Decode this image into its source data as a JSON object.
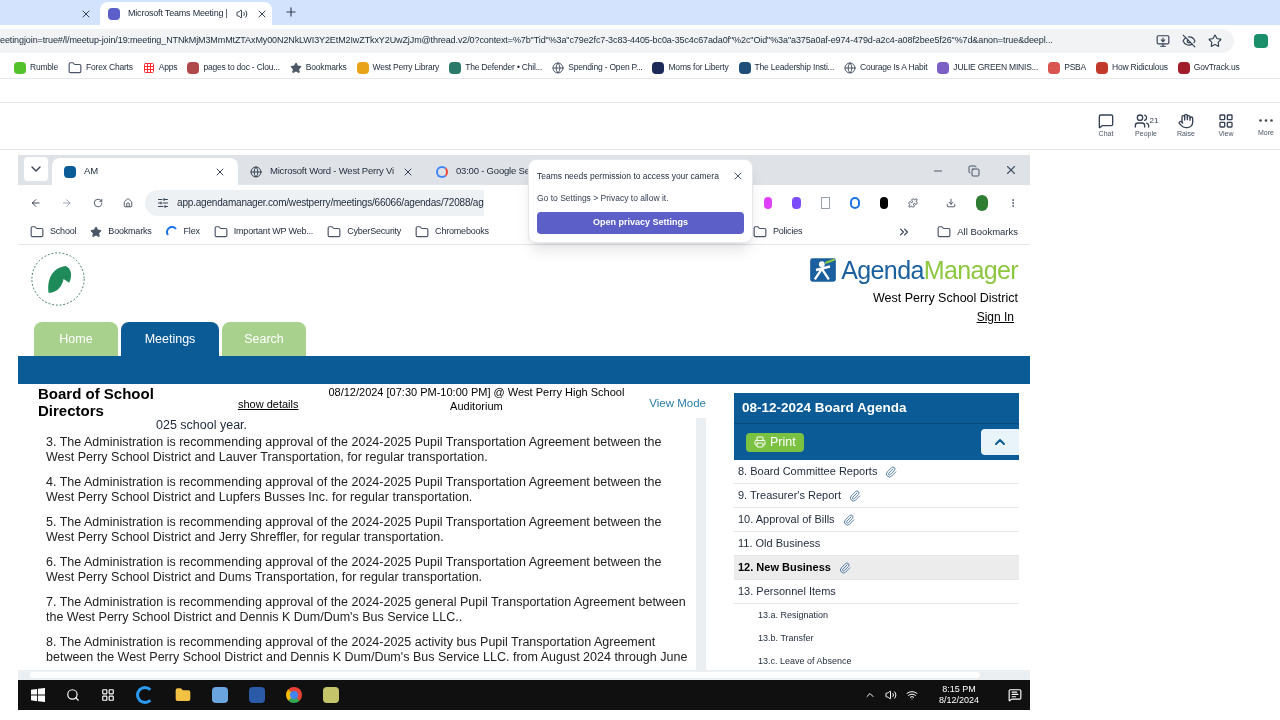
{
  "browser": {
    "tabs": [
      {
        "selected": false
      },
      {
        "title": "Microsoft Teams Meeting |",
        "selected": true,
        "audio": true
      }
    ],
    "url": "eetingjoin=true#/l/meetup-join/19:meeting_NTNkMjM3MmMtZTAxMy00N2NkLWI3Y2EtM2IwZTkxY2UwZjJm@thread.v2/0?context=%7b\"Tid\"%3a\"c79e2fc7-3c83-4405-bc0a-35c4c67ada0f\"%2c\"Oid\"%3a\"a375a0af-e974-479d-a2c4-a08f2bee5f26\"%7d&anon=true&deepl...",
    "bookmarks": [
      {
        "label": "Rumble",
        "kind": "site",
        "color": "#53c22b"
      },
      {
        "label": "Forex Charts",
        "kind": "folder"
      },
      {
        "label": "Apps",
        "kind": "apps"
      },
      {
        "label": "pages to doc - Clou...",
        "kind": "site",
        "color": "#b04a4a"
      },
      {
        "label": "Bookmarks",
        "kind": "star"
      },
      {
        "label": "West Perry Library",
        "kind": "site",
        "color": "#e8a317"
      },
      {
        "label": "The Defender • Chil...",
        "kind": "site",
        "color": "#2a7a6a"
      },
      {
        "label": "Spending - Open P...",
        "kind": "globe"
      },
      {
        "label": "Moms for Liberty",
        "kind": "site",
        "color": "#1c2a5a"
      },
      {
        "label": "The Leadership Insti...",
        "kind": "site",
        "color": "#1f4e79"
      },
      {
        "label": "Courage Is A Habit",
        "kind": "globe"
      },
      {
        "label": "JULIE GREEN MINIS...",
        "kind": "site",
        "color": "#7b5fc4"
      },
      {
        "label": "PSBA",
        "kind": "site",
        "color": "#d9534f"
      },
      {
        "label": "How Ridiculous",
        "kind": "site",
        "color": "#c0392b"
      },
      {
        "label": "GovTrack.us",
        "kind": "site",
        "color": "#a01d2a"
      }
    ]
  },
  "teams_toolbar": [
    {
      "label": "Chat",
      "kind": "chat"
    },
    {
      "label": "People",
      "kind": "people",
      "count": "21"
    },
    {
      "label": "Raise",
      "kind": "raise"
    },
    {
      "label": "View",
      "kind": "view"
    },
    {
      "label": "More",
      "kind": "more"
    }
  ],
  "shared_screen": {
    "browser": {
      "tabs": [
        {
          "title": "AM",
          "selected": true,
          "kind": "site"
        },
        {
          "title": "Microsoft Word - West Perry Vi",
          "selected": false,
          "kind": "globe"
        },
        {
          "title": "03:00 - Google Se",
          "selected": false,
          "kind": "google"
        }
      ],
      "url": "app.agendamanager.com/westperry/meetings/66066/agendas/72088/ag",
      "bookmarks": [
        {
          "label": "School",
          "kind": "folder"
        },
        {
          "label": "Bookmarks",
          "kind": "star"
        },
        {
          "label": "Flex",
          "kind": "flex"
        },
        {
          "label": "Important WP Web...",
          "kind": "folder"
        },
        {
          "label": "CyberSecurity",
          "kind": "folder"
        },
        {
          "label": "Chromebooks",
          "kind": "folder"
        },
        {
          "label": "Policies",
          "kind": "folder"
        }
      ],
      "all_bookmarks": "All Bookmarks"
    },
    "popup": {
      "title": "Teams needs permission to access your camera",
      "body": "Go to Settings > Privacy to allow it.",
      "button": "Open privacy Settings"
    },
    "page": {
      "brand": {
        "first": "Agenda",
        "second": "Manager"
      },
      "district": "West Perry School District",
      "sign_in": "Sign In",
      "nav": [
        {
          "label": "Home",
          "selected": false
        },
        {
          "label": "Meetings",
          "selected": true
        },
        {
          "label": "Search",
          "selected": false
        }
      ],
      "meeting": {
        "title": "Board of School Directors",
        "show_details": "show details",
        "datetime": "08/12/2024 [07:30 PM-10:00 PM] @ West Perry High School Auditorium",
        "view_mode": "View Mode"
      },
      "partial_line": "025 school year.",
      "items": [
        "3. The Administration is recommending approval of the 2024-2025 Pupil Transportation Agreement between the West Perry School District and Lauver Transportation, for regular transportation.",
        "4. The Administration is recommending approval of the 2024-2025 Pupil Transportation Agreement between the West Perry School District and Lupfers Busses Inc. for regular transportation.",
        "5. The Administration is recommending approval of the 2024-2025 Pupil Transportation Agreement between the West Perry School District and Jerry Shreffler, for regular transportation.",
        "6.  The Administration is recommending approval of the 2024-2025 Pupil Transportation Agreement between the West Perry School District and Dums Transportation, for regular transportation.",
        "7. The Administration is recommending approval of the 2024-2025 general Pupil Transportation Agreement between the West Perry School District and Dennis K Dum/Dum's Bus Service LLC..",
        "8.  The Administration is recommending approval of the 2024-2025 activity bus Pupil Transportation Agreement between the West Perry School District and Dennis K Dum/Dum's Bus Service LLC. from August 2024 through June"
      ],
      "agenda": {
        "title": "08-12-2024 Board Agenda",
        "print": "Print",
        "items": [
          {
            "number": "8.",
            "title": "Board Committee Reports",
            "attachment": true,
            "selected": false
          },
          {
            "number": "9.",
            "title": "Treasurer's Report",
            "attachment": true,
            "selected": false
          },
          {
            "number": "10.",
            "title": "Approval of Bills",
            "attachment": true,
            "selected": false
          },
          {
            "number": "11.",
            "title": "Old Business",
            "attachment": false,
            "selected": false
          },
          {
            "number": "12.",
            "title": "New Business",
            "attachment": true,
            "selected": true
          },
          {
            "number": "13.",
            "title": "Personnel Items",
            "attachment": false,
            "selected": false,
            "children": [
              {
                "number": "13.a.",
                "title": "Resignation",
                "selected": false
              },
              {
                "number": "13.b.",
                "title": "Transfer",
                "selected": false
              },
              {
                "number": "13.c.",
                "title": "Leave of Absence",
                "selected": false
              }
            ]
          }
        ]
      }
    },
    "taskbar": {
      "time": "8:15 PM",
      "date": "8/12/2024"
    }
  }
}
